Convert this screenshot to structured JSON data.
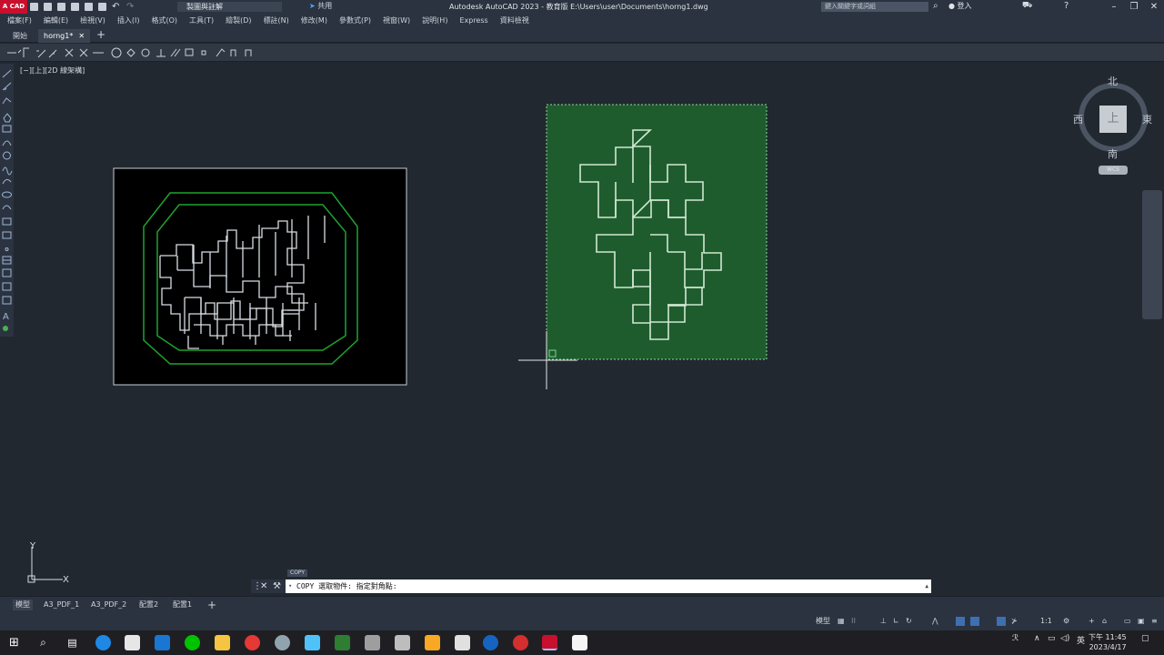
{
  "titlebar": {
    "logo": "A CAD",
    "workspace": "製圖與註解",
    "share": "共用",
    "title": "Autodesk AutoCAD 2023 - 教育版    E:\\Users\\user\\Documents\\horng1.dwg",
    "search_placeholder": "鍵入關鍵字或詞組",
    "login": "登入"
  },
  "menu": [
    "檔案(F)",
    "編輯(E)",
    "檢視(V)",
    "插入(I)",
    "格式(O)",
    "工具(T)",
    "繪製(D)",
    "標註(N)",
    "修改(M)",
    "參數式(P)",
    "視窗(W)",
    "說明(H)",
    "Express",
    "資料檢視"
  ],
  "tabs": {
    "start": "開始",
    "file": "horng1*"
  },
  "viewport": {
    "label": "[−][上][2D 線架構]"
  },
  "viewcube": {
    "north": "北",
    "south": "南",
    "east": "東",
    "west": "西",
    "face": "上",
    "wcs": "WCS"
  },
  "ucs": {
    "y": "Y",
    "x": "X"
  },
  "command": {
    "label": "COPY",
    "text": "COPY 選取物件: 指定對角點:"
  },
  "layout_tabs": [
    "模型",
    "A3_PDF_1",
    "A3_PDF_2",
    "配置2",
    "配置1"
  ],
  "statusbar": {
    "model": "模型",
    "scale": "1:1"
  },
  "taskbar": {
    "time": "下午 11:45",
    "date": "2023/4/17",
    "ime": "英"
  },
  "colors": {
    "background": "#212830",
    "selection_fill": "#1f5c2d",
    "outline_green": "#1fa32d",
    "maze_line": "#d8dde4",
    "cmd_bg": "#ffffff"
  }
}
